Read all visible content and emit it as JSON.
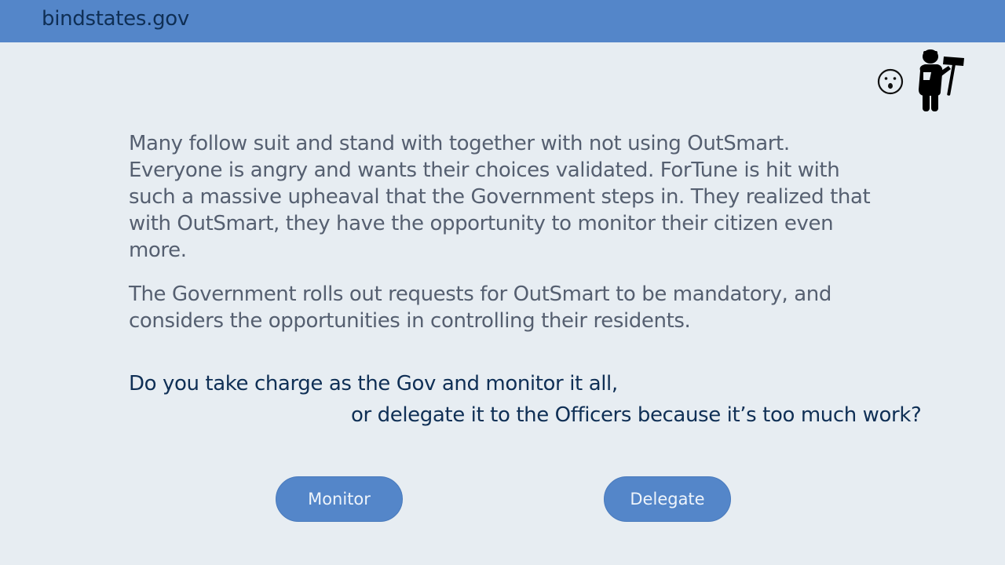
{
  "header": {
    "site_name": "bindstates.gov"
  },
  "icons": {
    "reaction": "surprised-face-icon",
    "character": "officer-figure-icon"
  },
  "story": {
    "paragraph_1": "Many follow suit and stand with together with not using OutSmart. Everyone is angry and wants their choices validated. ForTune is hit with such a massive upheaval that the Government steps in. They realized that with OutSmart, they have the opportunity to monitor their citizen even more.",
    "paragraph_2": "The Government rolls out requests for OutSmart to be mandatory, and considers the opportunities in controlling their residents."
  },
  "question": {
    "line_1": "Do you take charge as the Gov and monitor it all,",
    "line_2": "or delegate it to the Officers because it’s too much work?"
  },
  "choices": {
    "monitor_label": "Monitor",
    "delegate_label": "Delegate"
  },
  "colors": {
    "header_bg": "#5486c9",
    "page_bg": "#e7edf2",
    "button_bg": "#5486c9",
    "question_text": "#0f2f55",
    "body_text": "#555f70"
  }
}
